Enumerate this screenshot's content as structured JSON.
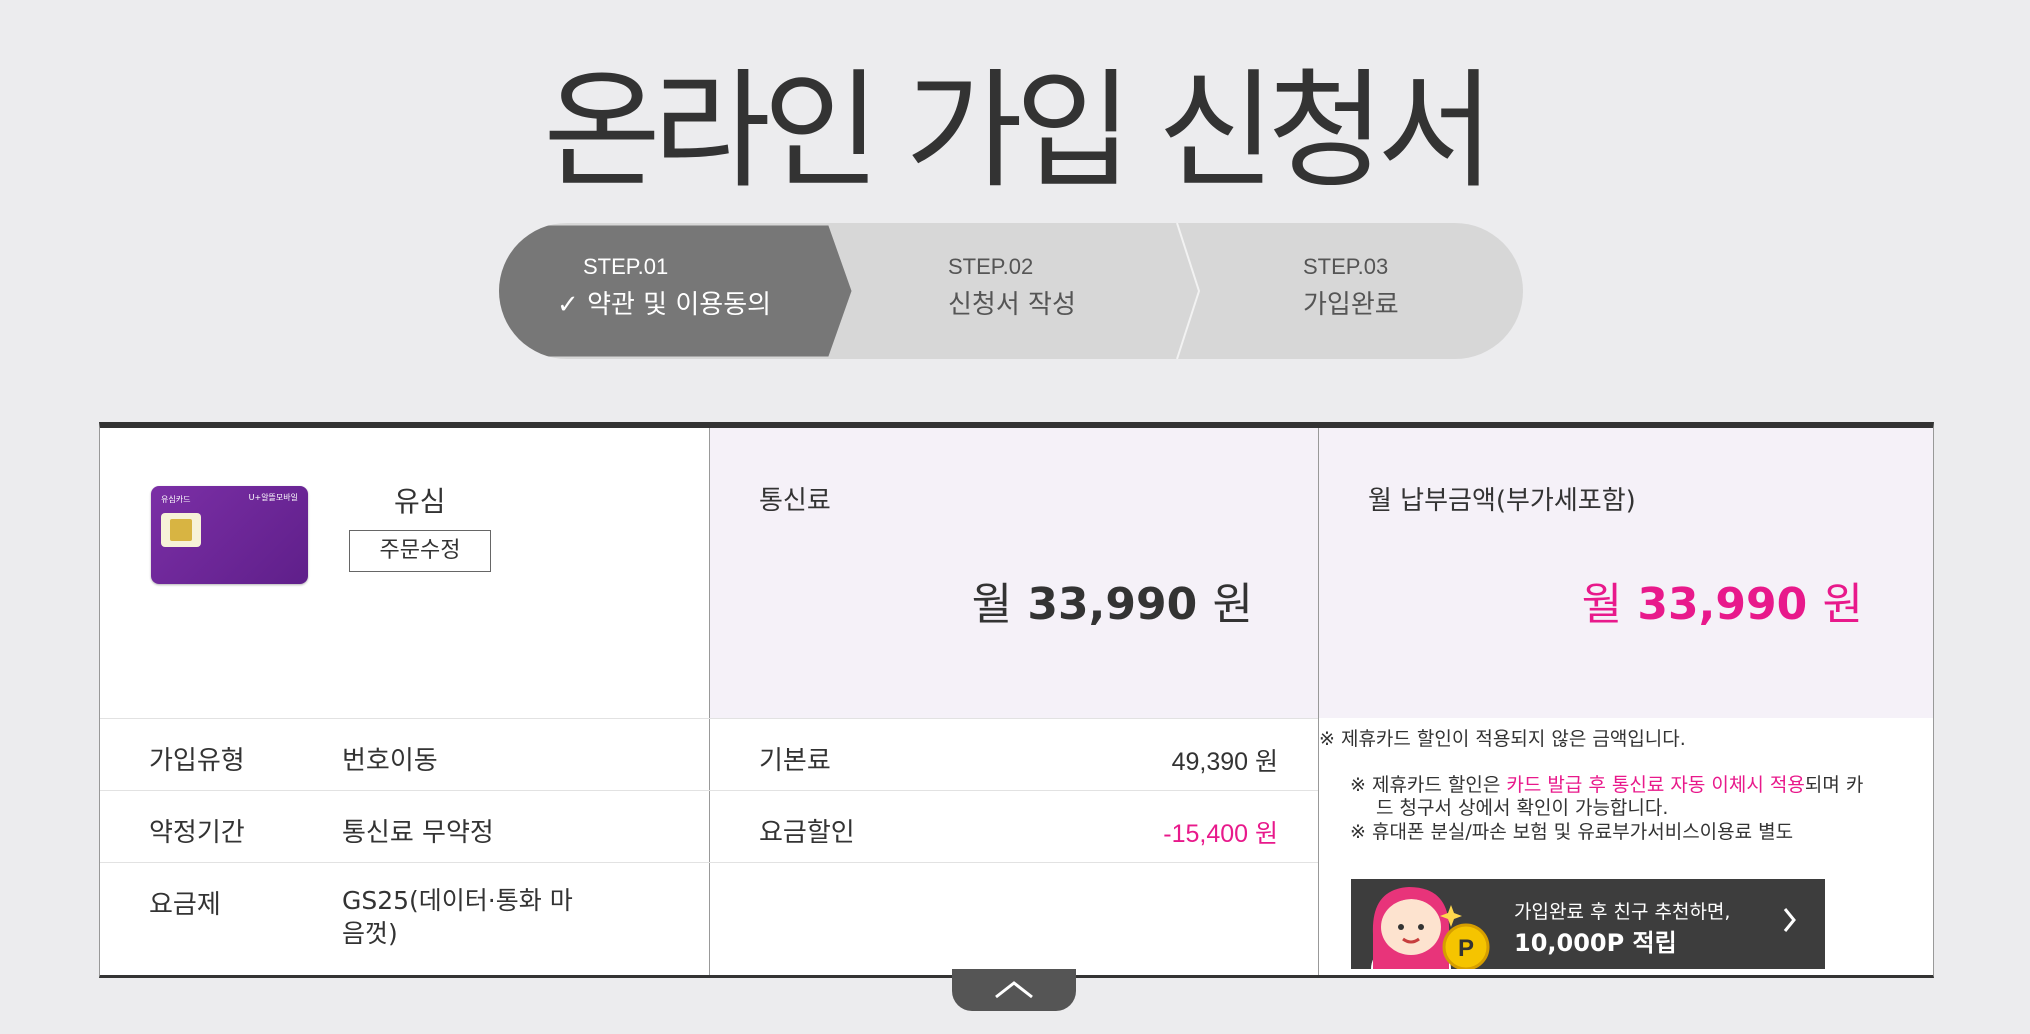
{
  "title": "온라인 가입 신청서",
  "steps": [
    {
      "num": "STEP.01",
      "label": "약관 및 이용동의",
      "active": true
    },
    {
      "num": "STEP.02",
      "label": "신청서 작성",
      "active": false
    },
    {
      "num": "STEP.03",
      "label": "가입완료",
      "active": false
    }
  ],
  "product": {
    "name": "유심",
    "edit_button": "주문수정",
    "card_text_left": "유심카드",
    "card_text_right": "U+알뜰모바일"
  },
  "rows": [
    {
      "label": "가입유형",
      "value": "번호이동"
    },
    {
      "label": "약정기간",
      "value": "통신료 무약정"
    },
    {
      "label": "요금제",
      "value_line1": "GS25(데이터·통화 마",
      "value_line2": "음껏)"
    }
  ],
  "fee": {
    "header": "통신료",
    "prefix": "월",
    "amount": "33,990",
    "unit": "원",
    "items": [
      {
        "label": "기본료",
        "amount": "49,390 원"
      },
      {
        "label": "요금할인",
        "amount": "-15,400 원"
      }
    ]
  },
  "monthly": {
    "header": "월 납부금액(부가세포함)",
    "prefix": "월",
    "amount": "33,990",
    "unit": "원",
    "note_top": "※ 제휴카드 할인이 적용되지 않은 금액입니다.",
    "note1_a": "※  제휴카드 할인은 ",
    "note1_highlight": "카드 발급 후 통신료 자동 이체시 적용",
    "note1_b": "되며 카",
    "note1_cont": "드 청구서 상에서 확인이 가능합니다.",
    "note2": "※  휴대폰 분실/파손 보험 및 유료부가서비스이용료 별도"
  },
  "banner": {
    "line1": "가입완료 후 친구 추천하면,",
    "line2": "10,000P 적립"
  },
  "colors": {
    "accent_pink": "#e8198b",
    "step_active": "#777777",
    "step_inactive": "#d7d7d7",
    "summary_bg": "#f5f1f8"
  }
}
